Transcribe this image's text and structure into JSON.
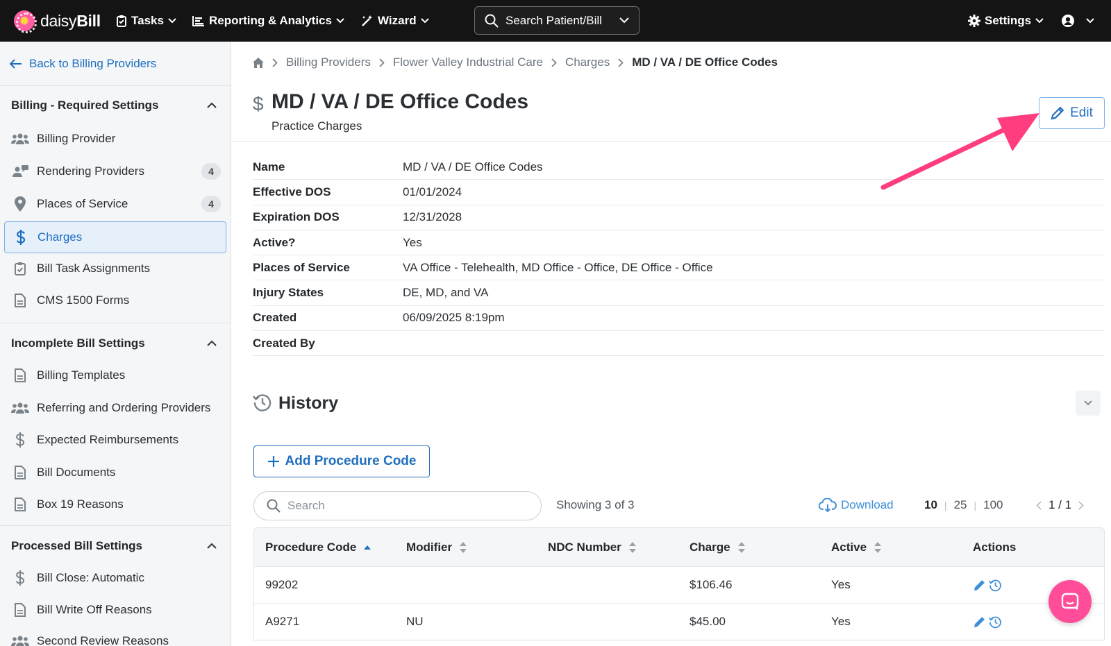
{
  "topnav": {
    "brand_prefix": "daisy",
    "brand_suffix": "Bill",
    "tasks": "Tasks",
    "reporting": "Reporting & Analytics",
    "wizard": "Wizard",
    "search_label": "Search Patient/Bill",
    "settings": "Settings"
  },
  "sidebar": {
    "back_label": "Back to Billing Providers",
    "sections": [
      {
        "title": "Billing - Required Settings",
        "items": [
          {
            "label": "Billing Provider",
            "icon": "users-icon"
          },
          {
            "label": "Rendering Providers",
            "icon": "user-chat-icon",
            "badge": "4"
          },
          {
            "label": "Places of Service",
            "icon": "map-pin-icon",
            "badge": "4"
          },
          {
            "label": "Charges",
            "icon": "dollar-icon",
            "active": true
          },
          {
            "label": "Bill Task Assignments",
            "icon": "clipboard-check-icon"
          },
          {
            "label": "CMS 1500 Forms",
            "icon": "document-icon"
          }
        ]
      },
      {
        "title": "Incomplete Bill Settings",
        "items": [
          {
            "label": "Billing Templates",
            "icon": "document-icon"
          },
          {
            "label": "Referring and Ordering Providers",
            "icon": "users-icon"
          },
          {
            "label": "Expected Reimbursements",
            "icon": "dollar-icon"
          },
          {
            "label": "Bill Documents",
            "icon": "document-icon"
          },
          {
            "label": "Box 19 Reasons",
            "icon": "document-icon"
          }
        ]
      },
      {
        "title": "Processed Bill Settings",
        "items": [
          {
            "label": "Bill Close: Automatic",
            "icon": "dollar-icon"
          },
          {
            "label": "Bill Write Off Reasons",
            "icon": "document-icon"
          },
          {
            "label": "Second Review Reasons",
            "icon": "users-icon"
          }
        ]
      }
    ]
  },
  "breadcrumb": [
    "Billing Providers",
    "Flower Valley Industrial Care",
    "Charges",
    "MD / VA / DE Office Codes"
  ],
  "header": {
    "title": "MD / VA / DE Office Codes",
    "subtitle": "Practice Charges",
    "edit_label": "Edit"
  },
  "details": [
    {
      "label": "Name",
      "value": "MD / VA / DE Office Codes"
    },
    {
      "label": "Effective DOS",
      "value": "01/01/2024"
    },
    {
      "label": "Expiration DOS",
      "value": "12/31/2028"
    },
    {
      "label": "Active?",
      "value": "Yes"
    },
    {
      "label": "Places of Service",
      "value": "VA Office - Telehealth, MD Office - Office, DE Office - Office"
    },
    {
      "label": "Injury States",
      "value": "DE, MD, and VA"
    },
    {
      "label": "Created",
      "value": "06/09/2025 8:19pm"
    },
    {
      "label": "Created By",
      "value": ""
    }
  ],
  "history": {
    "title": "History"
  },
  "procedures": {
    "add_label": "Add Procedure Code",
    "search_placeholder": "Search",
    "showing": "Showing 3 of 3",
    "download": "Download",
    "page_sizes": [
      "10",
      "25",
      "100"
    ],
    "page_info": "1 / 1",
    "columns": [
      "Procedure Code",
      "Modifier",
      "NDC Number",
      "Charge",
      "Active",
      "Actions"
    ],
    "rows": [
      {
        "code": "99202",
        "modifier": "",
        "ndc": "",
        "charge": "$106.46",
        "active": "Yes"
      },
      {
        "code": "A9271",
        "modifier": "NU",
        "ndc": "",
        "charge": "$45.00",
        "active": "Yes"
      }
    ]
  },
  "colors": {
    "accent": "#1f6fbf",
    "annotation_arrow": "#ff3d7f",
    "nav_bg": "#141414"
  }
}
